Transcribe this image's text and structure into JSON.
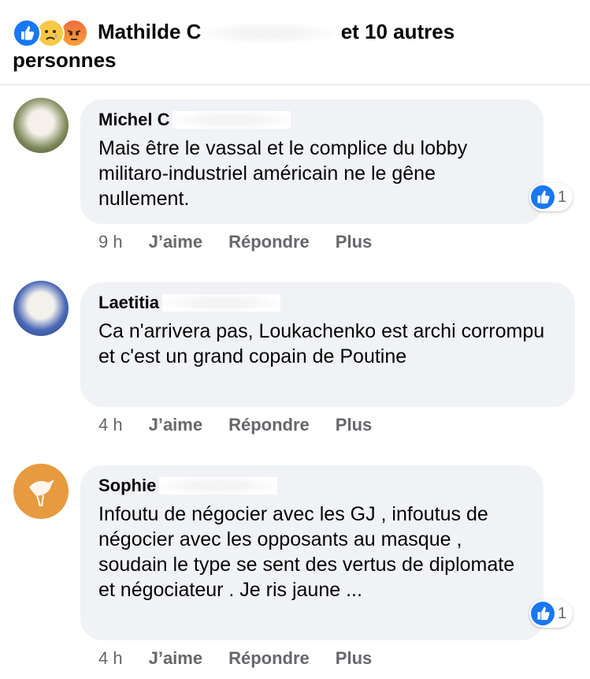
{
  "header": {
    "name_visible": "Mathilde C",
    "suffix": "et 10 autres personnes",
    "reactions": [
      "like-icon",
      "sad-icon",
      "angry-icon"
    ]
  },
  "actions": {
    "like": "J’aime",
    "reply": "Répondre",
    "more": "Plus"
  },
  "comments": [
    {
      "author": "Michel C",
      "text": "Mais être le vassal et le complice du lobby militaro-industriel américain ne le gêne nullement.",
      "time": "9 h",
      "likes": "1"
    },
    {
      "author": "Laetitia",
      "text": "Ca n'arrivera pas, Loukachenko est archi corrompu et c'est un grand copain de Poutine",
      "time": "4 h"
    },
    {
      "author": "Sophie",
      "text": "Infoutu de négocier avec les GJ , infoutus de négocier avec les opposants au masque , soudain le type se sent des vertus de diplomate et négociateur . Je ris jaune ...",
      "time": "4 h",
      "likes": "1"
    }
  ],
  "colors": {
    "accent": "#1877f2",
    "bubble": "#f0f2f5",
    "meta": "#65676b"
  }
}
